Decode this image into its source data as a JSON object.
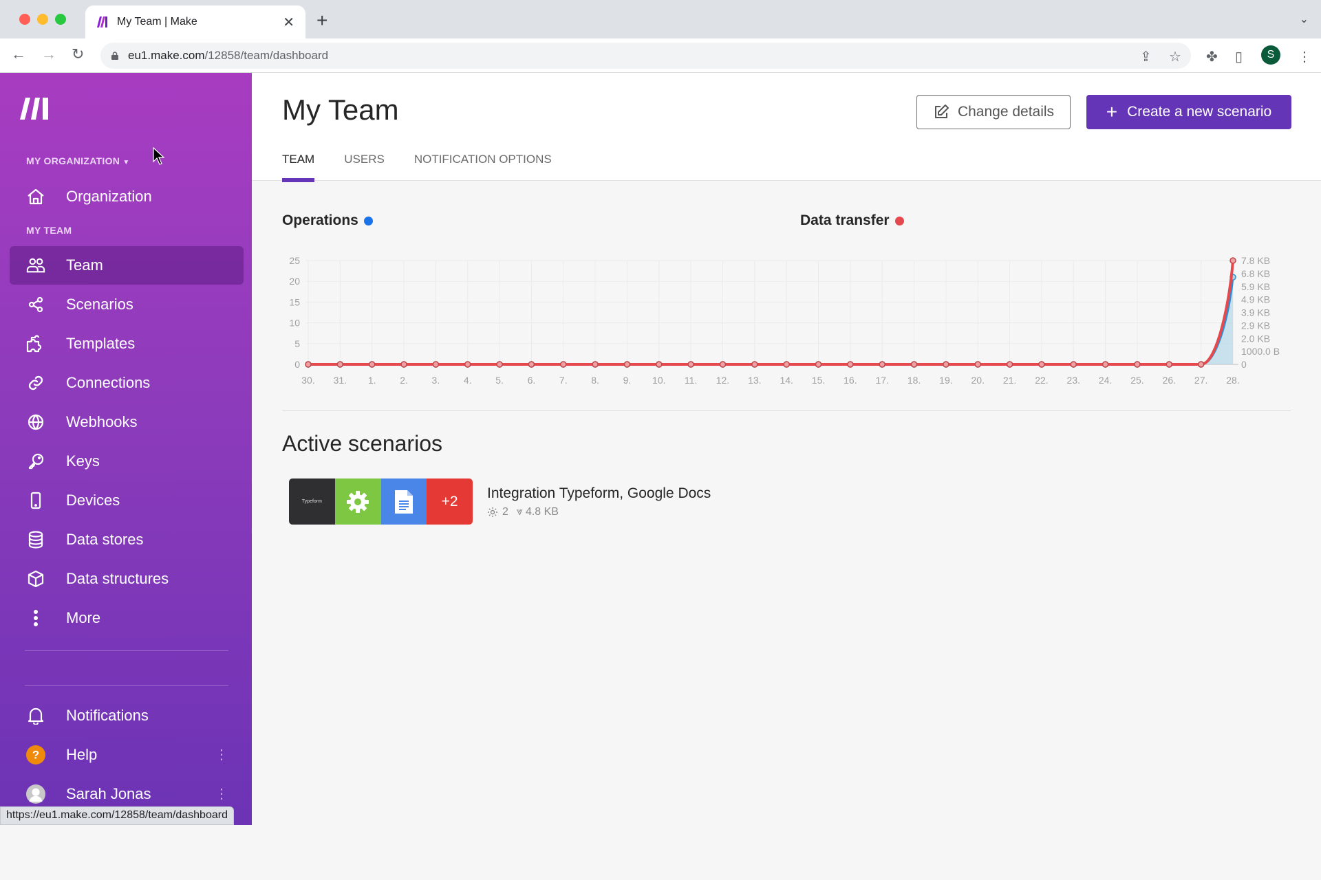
{
  "browser": {
    "tab_title": "My Team | Make",
    "url_host": "eu1.make.com",
    "url_path": "/12858/team/dashboard",
    "profile_initial": "S",
    "status_url": "https://eu1.make.com/12858/team/dashboard"
  },
  "sidebar": {
    "org_label": "MY ORGANIZATION",
    "team_section_label": "MY TEAM",
    "org_item": {
      "label": "Organization",
      "icon": "home-icon"
    },
    "items": [
      {
        "label": "Team",
        "icon": "users-icon",
        "active": true
      },
      {
        "label": "Scenarios",
        "icon": "share-nodes-icon"
      },
      {
        "label": "Templates",
        "icon": "puzzle-icon"
      },
      {
        "label": "Connections",
        "icon": "link-icon"
      },
      {
        "label": "Webhooks",
        "icon": "globe-icon"
      },
      {
        "label": "Keys",
        "icon": "key-icon"
      },
      {
        "label": "Devices",
        "icon": "mobile-icon"
      },
      {
        "label": "Data stores",
        "icon": "database-icon"
      },
      {
        "label": "Data structures",
        "icon": "cube-icon"
      },
      {
        "label": "More",
        "icon": "more-vertical-icon"
      }
    ],
    "bottom": [
      {
        "label": "Notifications",
        "icon": "bell-icon"
      },
      {
        "label": "Help",
        "icon": "help-circle-icon"
      },
      {
        "label": "Sarah Jonas",
        "icon": "avatar"
      }
    ]
  },
  "header": {
    "title": "My Team",
    "change_details": "Change details",
    "create_scenario": "Create a new scenario",
    "tabs": [
      {
        "label": "TEAM",
        "active": true
      },
      {
        "label": "USERS"
      },
      {
        "label": "NOTIFICATION OPTIONS"
      }
    ]
  },
  "colors": {
    "accent": "#6535b8",
    "operations": "#1a73e8",
    "data_transfer": "#e5484d"
  },
  "chart_data": {
    "type": "line",
    "titles": {
      "operations": "Operations",
      "data_transfer": "Data transfer"
    },
    "categories": [
      "30.",
      "31.",
      "1.",
      "2.",
      "3.",
      "4.",
      "5.",
      "6.",
      "7.",
      "8.",
      "9.",
      "10.",
      "11.",
      "12.",
      "13.",
      "14.",
      "15.",
      "16.",
      "17.",
      "18.",
      "19.",
      "20.",
      "21.",
      "22.",
      "23.",
      "24.",
      "25.",
      "26.",
      "27.",
      "28."
    ],
    "left_axis": {
      "label": "Operations",
      "ylim": [
        0,
        25
      ],
      "ticks": [
        "0",
        "5",
        "10",
        "15",
        "20",
        "25"
      ]
    },
    "right_axis": {
      "label": "Data transfer",
      "ylim_bytes": [
        0,
        7800
      ],
      "ticks": [
        "0",
        "1000.0 B",
        "2.0 KB",
        "2.9 KB",
        "3.9 KB",
        "4.9 KB",
        "5.9 KB",
        "6.8 KB",
        "7.8 KB"
      ]
    },
    "series": [
      {
        "name": "Operations",
        "axis": "left",
        "color": "#2b8fd6",
        "values": [
          0,
          0,
          0,
          0,
          0,
          0,
          0,
          0,
          0,
          0,
          0,
          0,
          0,
          0,
          0,
          0,
          0,
          0,
          0,
          0,
          0,
          0,
          0,
          0,
          0,
          0,
          0,
          0,
          0,
          21
        ]
      },
      {
        "name": "Data transfer",
        "axis": "right",
        "unit": "KB",
        "color": "#e5484d",
        "values": [
          0,
          0,
          0,
          0,
          0,
          0,
          0,
          0,
          0,
          0,
          0,
          0,
          0,
          0,
          0,
          0,
          0,
          0,
          0,
          0,
          0,
          0,
          0,
          0,
          0,
          0,
          0,
          0,
          0,
          7.8
        ]
      }
    ],
    "grid": true
  },
  "active": {
    "title": "Active scenarios",
    "scenarios": [
      {
        "name": "Integration Typeform, Google Docs",
        "apps": [
          "Typeform",
          "Tools",
          "Google Docs"
        ],
        "extra_apps": "+2",
        "operations": "2",
        "data": "4.8 KB"
      }
    ]
  }
}
